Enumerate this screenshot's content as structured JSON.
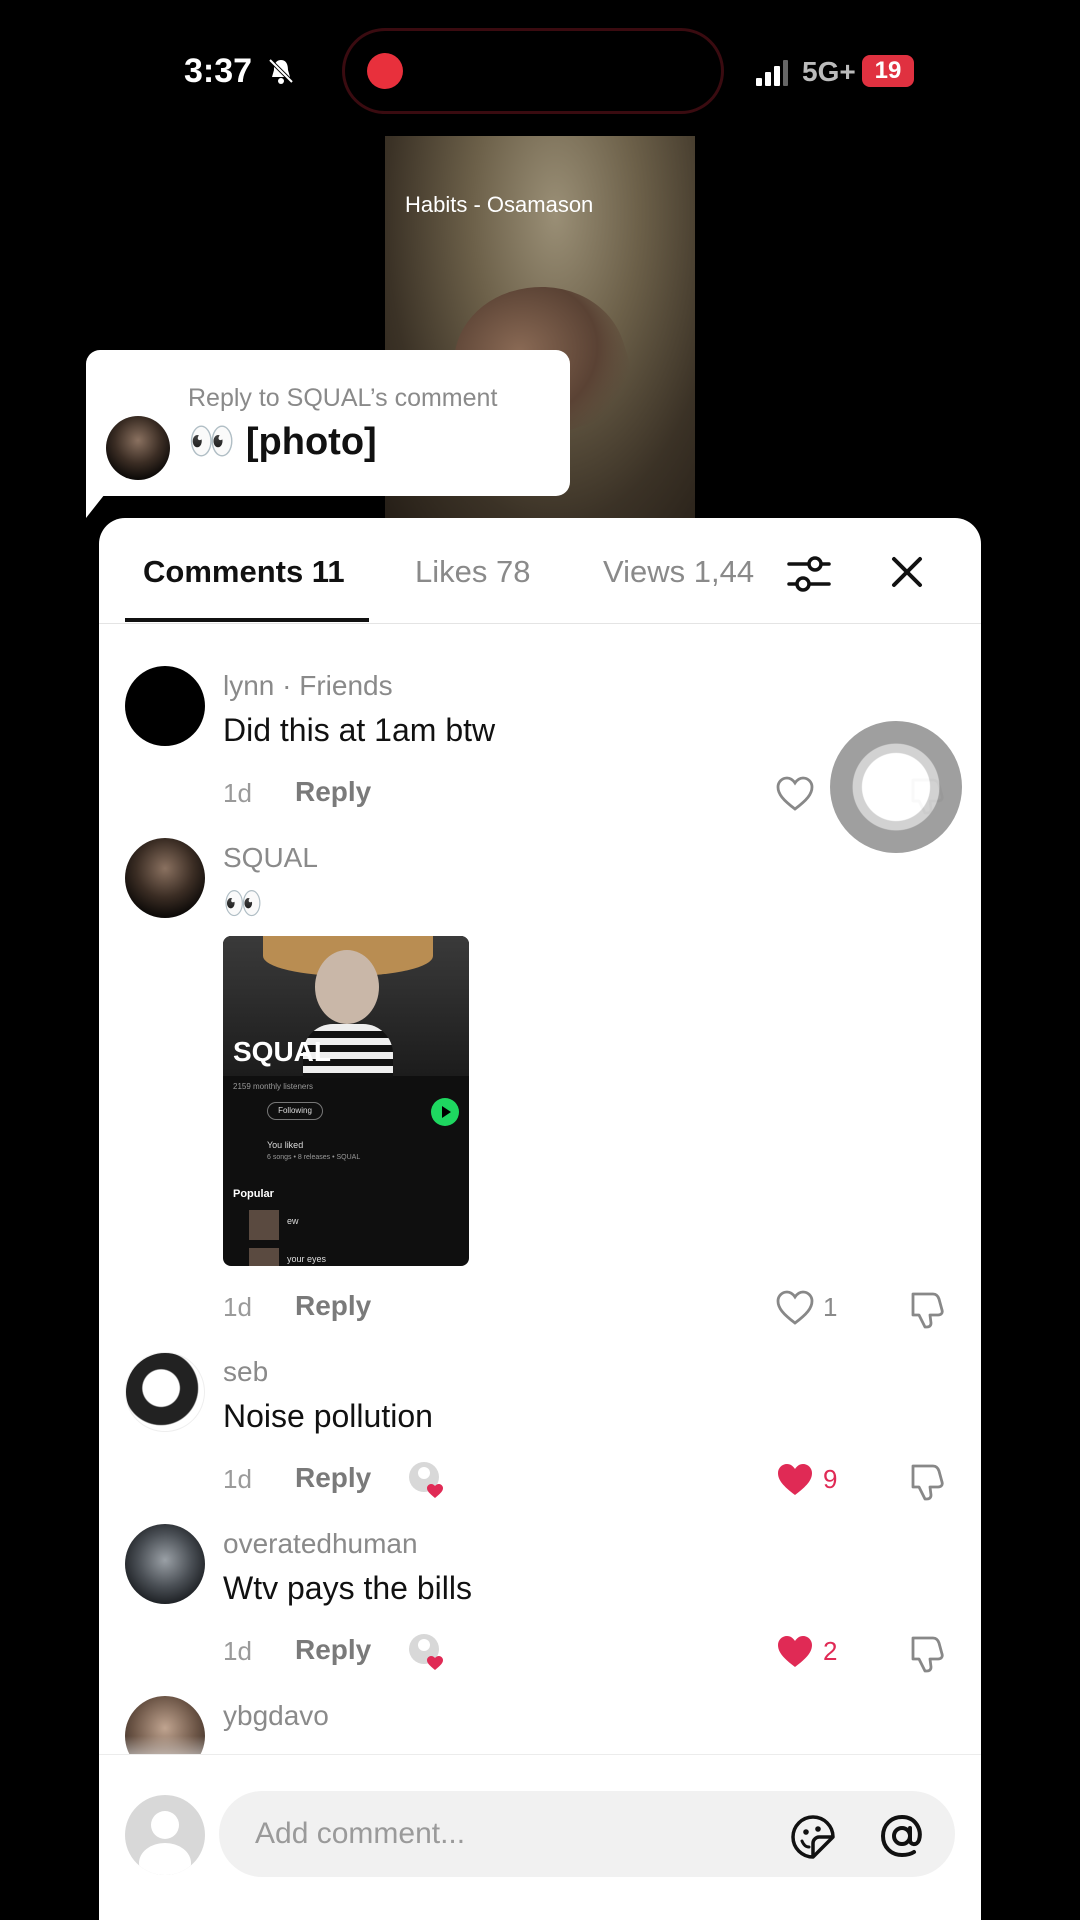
{
  "status_bar": {
    "time": "3:37",
    "network": "5G+",
    "battery": "19"
  },
  "video": {
    "title": "Habits - Osamason"
  },
  "reply_preview": {
    "label": "Reply to SQUAL’s comment",
    "text": "👀 [photo]"
  },
  "tabs": [
    {
      "label": "Comments 11",
      "active": true
    },
    {
      "label": "Likes 78",
      "active": false
    },
    {
      "label": "Views 1,44",
      "active": false
    }
  ],
  "comments": [
    {
      "user": "lynn · Friends",
      "text": "Did this at 1am btw",
      "time": "1d",
      "reply": "Reply",
      "likes": "",
      "liked": false
    },
    {
      "user": "SQUAL",
      "text": "👀",
      "time": "1d",
      "reply": "Reply",
      "likes": "1",
      "liked": false,
      "photo": {
        "name": "SQUAL",
        "sub": "2159 monthly listeners",
        "following": "Following",
        "liked_label": "You liked",
        "liked_sub": "6 songs • 8 releases • SQUAL",
        "popular": "Popular",
        "track1": "ew",
        "track2": "your eyes"
      }
    },
    {
      "user": "seb",
      "text": "Noise pollution",
      "time": "1d",
      "reply": "Reply",
      "likes": "9",
      "liked": true
    },
    {
      "user": "overatedhuman",
      "text": "Wtv pays the bills",
      "time": "1d",
      "reply": "Reply",
      "likes": "2",
      "liked": true
    },
    {
      "user": "ybgdavo"
    }
  ],
  "input": {
    "placeholder": "Add comment..."
  },
  "colors": {
    "liked_red": "#e02a55",
    "recording_red": "#e8303c",
    "spotify_green": "#1ed760"
  },
  "icons": [
    "bell-muted-icon",
    "signal-icon",
    "filter-icon",
    "close-icon",
    "heart-icon",
    "dislike-icon",
    "emoji-icon",
    "at-icon"
  ]
}
